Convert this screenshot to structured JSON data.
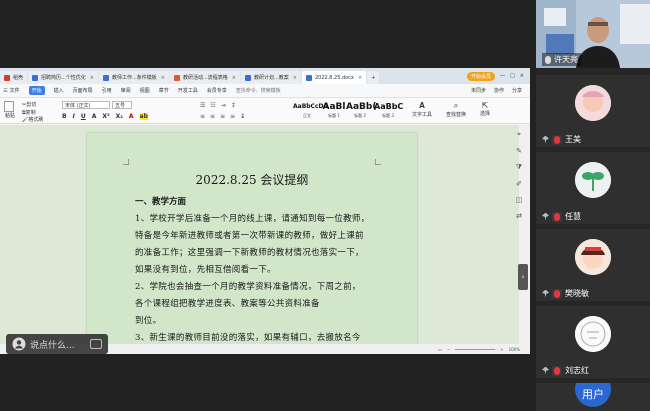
{
  "tabs": [
    {
      "label": "稻壳",
      "icon_color": "#d43b2a"
    },
    {
      "label": "招聘简历...个性优化",
      "icon_color": "#3b6fd6"
    },
    {
      "label": "教师工作...条件模板",
      "icon_color": "#3b6fd6"
    },
    {
      "label": "教研活动...流程表格",
      "icon_color": "#e05a2b"
    },
    {
      "label": "教研计划...教案",
      "icon_color": "#3b6fd6"
    },
    {
      "label": "2022.8.25.docx",
      "icon_color": "#3b6fd6",
      "active": true
    }
  ],
  "tabbar_user": "开始会员",
  "menus": [
    "三 文件",
    "开始",
    "插入",
    "页面布局",
    "引用",
    "审阅",
    "视图",
    "章节",
    "开发工具",
    "会员专享"
  ],
  "menu_right": [
    "未同步",
    "协作",
    "分享"
  ],
  "search_placeholder": "查找命令、搜索模板",
  "ribbon": {
    "paste": "粘贴",
    "cut": "剪切",
    "copy": "复制",
    "format_painter": "格式刷",
    "font": "宋体 (正文)",
    "font_size": "五号",
    "styles": [
      {
        "sample": "AaBbCcDd",
        "name": "正文"
      },
      {
        "sample": "AaBl",
        "name": "标题 1"
      },
      {
        "sample": "AaBb(",
        "name": "标题 2"
      },
      {
        "sample": "AaBbC",
        "name": "标题 3"
      }
    ],
    "text_tools": "文字工具",
    "find_replace": "查找替换",
    "select": "选择"
  },
  "document": {
    "title": "2022.8.25 会议提纲",
    "section": "一、教学方面",
    "lines": [
      "1、学校开学后准备一个月的线上课，请通知到每一位教师，",
      "特备是今年新进教师或者第一次带新课的教师，做好上课前",
      "的准备工作；这里强调一下新教师的教材情况也落实一下，",
      "如果没有到位，先相互借阅看一下。",
      "2、学院也会抽查一个月的教学资料准备情况，下周之前，",
      "各个课程组把教学进度表、教案等公共资料准备",
      "到位。",
      "3、新生课的教师目前没的落实，如果有辅口，去搬放名今"
    ]
  },
  "chat_placeholder": "说点什么...",
  "zoom": "100%",
  "participants": [
    {
      "name": "许天亮",
      "type": "camera"
    },
    {
      "name": "王美",
      "avatar_color": "#f2d7d9"
    },
    {
      "name": "任慧",
      "avatar_color": "#e9eef0"
    },
    {
      "name": "樊晓敏",
      "avatar_color": "#f5e6dc"
    },
    {
      "name": "刘志红",
      "avatar_color": "#ffffff"
    },
    {
      "name": "用户",
      "avatar_color": "#2a67d1"
    }
  ]
}
